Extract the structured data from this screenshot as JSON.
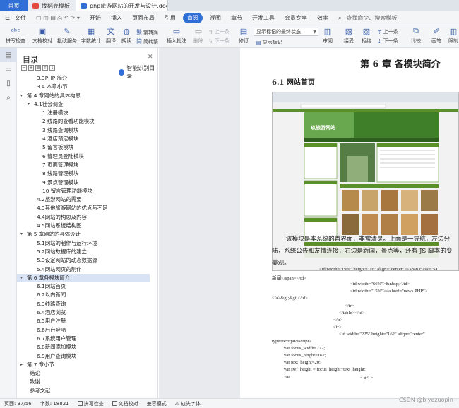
{
  "tabs": {
    "home": "首页",
    "template": "找稻壳模板",
    "doc": "php旅游网站的开发与设计.doc"
  },
  "menu": {
    "file": "文件",
    "items": [
      "开始",
      "插入",
      "页面布局",
      "引用",
      "审阅",
      "视图",
      "章节",
      "开发工具",
      "会员专享",
      "效率"
    ],
    "active_index": 4,
    "search": "查找命令、搜索模板"
  },
  "ribbon": {
    "spell": "拼写检查",
    "proof": "文档校对",
    "batch": "批改服务",
    "wordcount": "字数统计",
    "translate": "翻译",
    "read": "朗读",
    "trad": "繁转简",
    "simp": "简转繁",
    "insert_comment": "插入批注",
    "delete": "删除",
    "prev_comment": "上一条",
    "next_comment": "下一条",
    "revise": "修订",
    "show_select": "显示标记的最终状态",
    "show_marks": "显示标记",
    "review": "审阅",
    "accept": "接受",
    "reject": "拒绝",
    "prev": "上一条",
    "next": "下一条",
    "compare": "比较",
    "draw": "画笔",
    "limit": "限制"
  },
  "toc": {
    "title": "目录",
    "ai": "智能识别目录",
    "items": [
      {
        "text": "3.3PHP 简介",
        "level": 2
      },
      {
        "text": "3.4 本章小节",
        "level": 2
      },
      {
        "text": "第 4 章网站的具体构思",
        "level": 1,
        "arrow": "down"
      },
      {
        "text": "4.1社会调查",
        "level": 2,
        "arrow": "down"
      },
      {
        "text": "1 注册模块",
        "level": 3
      },
      {
        "text": "2 线路的查看功能模块",
        "level": 3
      },
      {
        "text": "3 线路查询模块",
        "level": 3
      },
      {
        "text": "4  酒店预定模块",
        "level": 3
      },
      {
        "text": "5    留言板模块",
        "level": 3
      },
      {
        "text": "6 管理员登陆模块",
        "level": 3
      },
      {
        "text": "7 页面管理模块",
        "level": 3
      },
      {
        "text": "8 线路管理模块",
        "level": 3
      },
      {
        "text": "9  景点管理模块",
        "level": 3
      },
      {
        "text": "10 留言管理功能模块",
        "level": 3
      },
      {
        "text": "4.2旅游网站的需要",
        "level": 2
      },
      {
        "text": "4.3其他旅游网站的优点与不足",
        "level": 2
      },
      {
        "text": "4.4网站的构思及内容",
        "level": 2
      },
      {
        "text": "4.5网站系统结构图",
        "level": 2
      },
      {
        "text": "第 5 章网站的具体设计",
        "level": 1,
        "arrow": "down"
      },
      {
        "text": "5.1网站的制作与运行环境",
        "level": 2
      },
      {
        "text": "5.2网站数据库的建立",
        "level": 2
      },
      {
        "text": "5.3设定网站的动态数据源",
        "level": 2
      },
      {
        "text": "5.4网站网页的制作",
        "level": 2
      },
      {
        "text": "第 6 章各模块简介",
        "level": 1,
        "arrow": "down",
        "selected": true
      },
      {
        "text": "6.1网站首页",
        "level": 2
      },
      {
        "text": "6.2以内新闻",
        "level": 2
      },
      {
        "text": "6.3线路查询",
        "level": 2
      },
      {
        "text": "6.4酒店浏览",
        "level": 2
      },
      {
        "text": "6.5用户注册",
        "level": 2
      },
      {
        "text": "6.6后台登陆",
        "level": 2
      },
      {
        "text": "6.7系统用户管理",
        "level": 2
      },
      {
        "text": "6.8新闻添加模块",
        "level": 2
      },
      {
        "text": "6.9用户查询模块",
        "level": 2
      },
      {
        "text": "第 7 章小节",
        "level": 1,
        "arrow": "right"
      },
      {
        "text": "结论",
        "level": 1
      },
      {
        "text": "致谢",
        "level": 1
      },
      {
        "text": "参考文献",
        "level": 1
      }
    ]
  },
  "page": {
    "chapter_title": "第 6 章  各模块简介",
    "section_title": "6.1  网站首页",
    "screenshot_site_title": "玖旅游网站",
    "para1": "该模块是本系统的首界面，非常清灵。上面是一导航，左边分",
    "para2": "陆，系统公告和友情连接，右边是新闻，景点等，还有 JS 脚本的变",
    "para3": "美观。",
    "code": [
      "<td width=\"19%\" height=\"16\" align=\"center\"><span class=\"ST",
      "新闻</span></td>",
      "<td width=\"66%\">&nbsp;</td>",
      "<td        width=\"15%\"><a        href=\"news.PHP\">",
      "</a>&gt;&gt;</td>",
      "</tr>",
      "</table></td>",
      "</tr>",
      "<tr>",
      "<td     width=\"225\"     height=\"162\"     align=\"center\"",
      "type=text/javascript>",
      "var focus_width=222;",
      "var focus_height=162;",
      "var text_height=20;",
      "var swf_height = focus_height+text_height;",
      "var"
    ],
    "page_number": "- 34 -"
  },
  "status": {
    "page": "页面: 37/56",
    "words": "字数: 18821",
    "spell": "拼写检查",
    "proof": "文档校对",
    "compat": "兼容模式",
    "missing_font": "缺失字体"
  },
  "watermark": "CSDN @biyezuopin",
  "colors": {
    "accent": "#2f6fd6",
    "site_green": "#5a8f2a"
  }
}
